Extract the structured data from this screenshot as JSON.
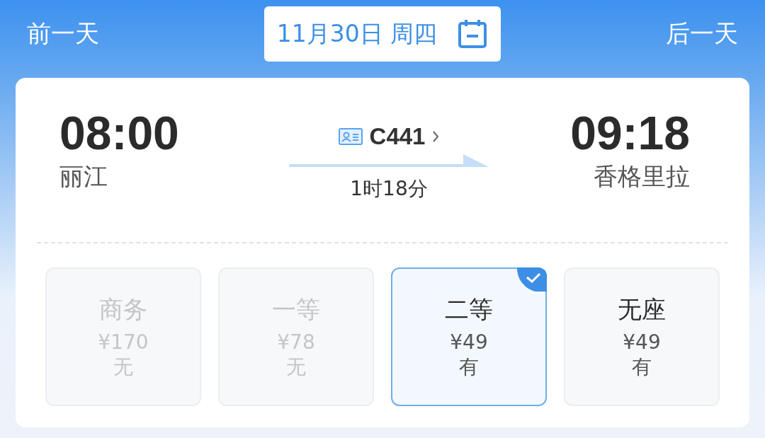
{
  "nav": {
    "previous": "前一天",
    "date": "11月30日 周四",
    "next": "后一天"
  },
  "train": {
    "depart_time": "08:00",
    "depart_station": "丽江",
    "number": "C441",
    "duration": "1时18分",
    "arrive_time": "09:18",
    "arrive_station": "香格里拉"
  },
  "seats": [
    {
      "name": "商务",
      "price": "¥170",
      "availability": "无",
      "disabled": true,
      "selected": false
    },
    {
      "name": "一等",
      "price": "¥78",
      "availability": "无",
      "disabled": true,
      "selected": false
    },
    {
      "name": "二等",
      "price": "¥49",
      "availability": "有",
      "disabled": false,
      "selected": true
    },
    {
      "name": "无座",
      "price": "¥49",
      "availability": "有",
      "disabled": false,
      "selected": false
    }
  ]
}
